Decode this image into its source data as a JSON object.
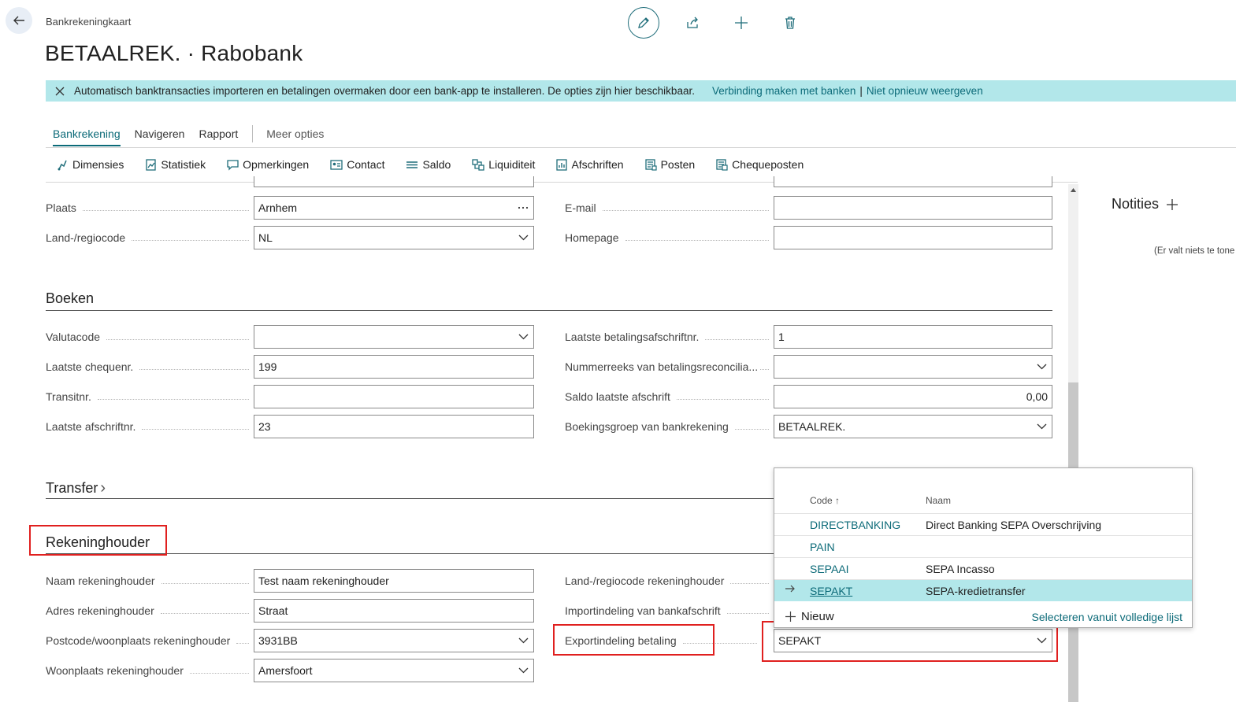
{
  "header": {
    "breadcrumb": "Bankrekeningkaart",
    "title": "BETAALREK. · Rabobank"
  },
  "banner": {
    "message": "Automatisch banktransacties importeren en betalingen overmaken door een bank-app te installeren. De opties zijn hier beschikbaar.",
    "link_connect": "Verbinding maken met banken",
    "separator": "|",
    "link_dismiss": "Niet opnieuw weergeven"
  },
  "tabs": {
    "t1": "Bankrekening",
    "t2": "Navigeren",
    "t3": "Rapport",
    "more": "Meer opties"
  },
  "actions": {
    "a1": "Dimensies",
    "a2": "Statistiek",
    "a3": "Opmerkingen",
    "a4": "Contact",
    "a5": "Saldo",
    "a6": "Liquiditeit",
    "a7": "Afschriften",
    "a8": "Posten",
    "a9": "Chequeposten"
  },
  "general": {
    "plaats_label": "Plaats",
    "plaats_value": "Arnhem",
    "land_label": "Land-/regiocode",
    "land_value": "NL",
    "email_label": "E-mail",
    "email_value": "",
    "homepage_label": "Homepage",
    "homepage_value": ""
  },
  "boeken": {
    "title": "Boeken",
    "valutacode_label": "Valutacode",
    "valutacode_value": "",
    "chequenr_label": "Laatste chequenr.",
    "chequenr_value": "199",
    "transitnr_label": "Transitnr.",
    "transitnr_value": "",
    "afschriftnr_label": "Laatste afschriftnr.",
    "afschriftnr_value": "23",
    "betaalafschrift_label": "Laatste betalingsafschriftnr.",
    "betaalafschrift_value": "1",
    "nummerreeks_label": "Nummerreeks van betalingsreconcilia...",
    "nummerreeks_value": "",
    "saldo_label": "Saldo laatste afschrift",
    "saldo_value": "0,00",
    "boekingsgroep_label": "Boekingsgroep van bankrekening",
    "boekingsgroep_value": "BETAALREK."
  },
  "transfer": {
    "title": "Transfer",
    "chevron": "›"
  },
  "rekeninghouder": {
    "title": "Rekeninghouder",
    "naam_label": "Naam rekeninghouder",
    "naam_value": "Test naam rekeninghouder",
    "adres_label": "Adres rekeninghouder",
    "adres_value": "Straat",
    "postcode_label": "Postcode/woonplaats rekeninghouder",
    "postcode_value": "3931BB",
    "woonplaats_label": "Woonplaats rekeninghouder",
    "woonplaats_value": "Amersfoort",
    "land_label": "Land-/regiocode rekeninghouder",
    "import_label": "Importindeling van bankafschrift",
    "export_label": "Exportindeling betaling",
    "export_value": "SEPAKT"
  },
  "factbox": {
    "title": "Notities",
    "empty": "(Er valt niets te tone"
  },
  "lookup": {
    "col_code": "Code ↑",
    "col_name": "Naam",
    "rows": [
      {
        "code": "DIRECTBANKING",
        "name": "Direct Banking SEPA Overschrijving"
      },
      {
        "code": "PAIN",
        "name": ""
      },
      {
        "code": "SEPAAI",
        "name": "SEPA Incasso"
      },
      {
        "code": "SEPAKT",
        "name": "SEPA-kredietransfer"
      }
    ],
    "new_label": "Nieuw",
    "full_list": "Selecteren vanuit volledige lijst"
  },
  "colors": {
    "accent": "#0b6a78",
    "banner_bg": "#b2e7ea",
    "highlight_red": "#e0201f"
  }
}
